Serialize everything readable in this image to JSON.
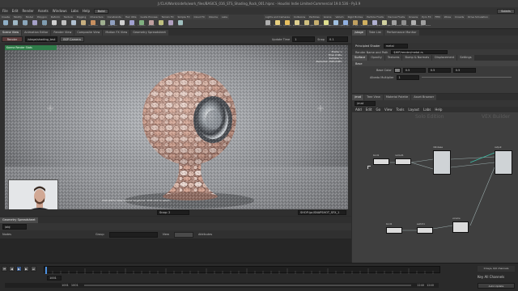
{
  "app": {
    "title": "J:/CLA/Work/sidefx/work_files/BASICS_016_STS_Shading_Rock_001.hipnc - Houdini Indie Limited-Commercial 19.0.536 - Py3.9"
  },
  "menubar": {
    "items": [
      "File",
      "Edit",
      "Render",
      "Assets",
      "Windows",
      "Labs",
      "Help"
    ],
    "build": "Build",
    "desktop": "Solaris",
    "right_label": "Main"
  },
  "shelf": {
    "left_tabs": [
      "Create",
      "Modify",
      "Model",
      "Polygon",
      "Deform",
      "Texture",
      "Rigging",
      "Characters",
      "Constraints",
      "Hair Utils",
      "Guide Process",
      "Terrain FX",
      "Simple FX",
      "Cloud FX",
      "Volume",
      "Labs"
    ],
    "right_tabs": [
      "Lights and Cameras",
      "Collisions",
      "Particles",
      "Grains",
      "Vellum",
      "Rigid Bodies",
      "Particle Fluids",
      "Viscous Fluids",
      "Oceans",
      "Pyro FX",
      "FEM",
      "Wires",
      "Crowds",
      "Drive Simulation"
    ],
    "left_tools": [
      {
        "label": "Box",
        "color": "#8fb0c8"
      },
      {
        "label": "Sphere",
        "color": "#9fb8c6"
      },
      {
        "label": "Tube",
        "color": "#8aa6bb"
      },
      {
        "label": "Torus",
        "color": "#a5a0c8"
      },
      {
        "label": "Grid",
        "color": "#7f9cb0"
      },
      {
        "label": "Null",
        "color": "#d0d0d0"
      },
      {
        "label": "Line",
        "color": "#c0c0c0"
      },
      {
        "label": "Circle",
        "color": "#b0c0d0"
      },
      {
        "label": "Curve",
        "color": "#c8b080"
      },
      {
        "label": "Draw Curve",
        "color": "#c89060"
      },
      {
        "label": "Path",
        "color": "#a0b090"
      },
      {
        "label": "Spray Paint",
        "color": "#90a0c0"
      },
      {
        "label": "Font",
        "color": "#d0d0d0"
      },
      {
        "label": "Platonic",
        "color": "#a0a0d0"
      },
      {
        "label": "L-System",
        "color": "#80b080"
      },
      {
        "label": "Metaball",
        "color": "#c0a0a0"
      },
      {
        "label": "File",
        "color": "#c0c080"
      },
      {
        "label": "Spiral",
        "color": "#b0a0c0"
      },
      {
        "label": "Helix",
        "color": "#a0c0c0"
      }
    ],
    "right_tools": [
      {
        "label": "Camera",
        "color": "#b0b0b0"
      },
      {
        "label": "Point Light",
        "color": "#e8d080"
      },
      {
        "label": "Spot Light",
        "color": "#e8c060"
      },
      {
        "label": "Area Light",
        "color": "#e0d090"
      },
      {
        "label": "Geometry Light",
        "color": "#d0c080"
      },
      {
        "label": "Volume Light",
        "color": "#c8b070"
      },
      {
        "label": "Distant Light",
        "color": "#e0e090"
      },
      {
        "label": "Environment Light",
        "color": "#a0c0e0"
      },
      {
        "label": "Sky Light",
        "color": "#90b0e0"
      },
      {
        "label": "GI Light",
        "color": "#c0a060"
      },
      {
        "label": "Caustic Light",
        "color": "#d0b060"
      },
      {
        "label": "Portal Light",
        "color": "#b0b0d0"
      },
      {
        "label": "Ambient Light",
        "color": "#d0d0a0"
      },
      {
        "label": "Stereo Camera",
        "color": "#a0a0a0"
      },
      {
        "label": "VR Camera",
        "color": "#909090"
      },
      {
        "label": "Switcher",
        "color": "#b0b0b0"
      },
      {
        "label": "Gamepad Camera",
        "color": "#a0a0a0"
      }
    ]
  },
  "viewport": {
    "tabs": [
      "Scene View",
      "Animation Editor",
      "Render View",
      "Composite View",
      "Motion FX View",
      "Geometry Spreadsheet"
    ],
    "stage_path": "/stage/shading_test",
    "render_button": "Render",
    "camera": "BSP Camera",
    "update_time_label": "Update Time",
    "update_time": "1",
    "snap_label": "Snap",
    "snap_value": "0.1",
    "render_badge": "Karma Render Stats",
    "stats": [
      "Frame: 1",
      "Time: 0.84s",
      "Samples: 1",
      "Resolution 1920x1080"
    ],
    "bottom_text": "Click left to draw desired target/red. Shift-click to select.",
    "snap_field": "Snap: 2",
    "snapshot_path": "SHOP:/pr/SNAPSHOT_SFX_1"
  },
  "spreadsheet": {
    "tabs": [
      "Geometry Spreadsheet"
    ],
    "path": "/obj",
    "filter_label": "Nodes",
    "group_label": "Group",
    "view_label": "View",
    "attrs_label": "Attributes"
  },
  "timeline": {
    "start": "1001",
    "end": "1240",
    "current": "1001",
    "range_start": "1001",
    "range_end": "1240",
    "channels_label": "0 keys, 0/0 channels",
    "auto_update": "Auto Update",
    "key_all": "Key All Channels"
  },
  "params": {
    "tabs": [
      "/stage",
      "Take List",
      "Performance Monitor"
    ],
    "node_type": "Principled Shader",
    "node_name": "metal",
    "sub_tabs": [
      "Surface",
      "Opacity",
      "Textures",
      "Bump & Normals",
      "Displacement",
      "Settings"
    ],
    "path_label": "Render Name and Path",
    "path_value": "$HIP/render/metal.rs",
    "section": "Base",
    "base_color_label": "Base Color",
    "base_color_values": [
      "0.5",
      "0.5",
      "0.5"
    ],
    "albedo_label": "Albedo Multiplier",
    "albedo_value": "1"
  },
  "network": {
    "tabs": [
      "/mat",
      "Tree View",
      "Material Palette",
      "Asset Browser"
    ],
    "path": "/mat",
    "menu": [
      "Add",
      "Edit",
      "Go",
      "View",
      "Tools",
      "Layout",
      "Labs",
      "Help"
    ],
    "watermark": "Solo Edition",
    "builder_label": "VEX Builder",
    "nodes": [
      {
        "label": "bind1",
        "type": "small"
      },
      {
        "label": "nullout1",
        "type": "small"
      },
      {
        "label": "mtlxbase",
        "type": "tall"
      },
      {
        "label": "output",
        "type": "tall"
      },
      {
        "label": "principled",
        "type": "tall"
      },
      {
        "label": "bind2",
        "type": "small"
      },
      {
        "label": "switch1",
        "type": "small"
      },
      {
        "label": "volume",
        "type": "med"
      }
    ]
  }
}
